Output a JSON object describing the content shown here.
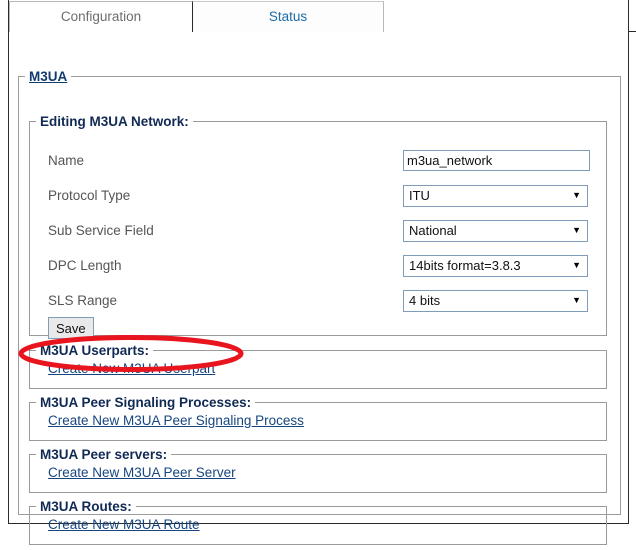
{
  "tabs": [
    {
      "id": "configuration",
      "label": "Configuration",
      "active": true
    },
    {
      "id": "status",
      "label": "Status",
      "active": false
    }
  ],
  "panel": {
    "legend": "M3UA",
    "editing_section": {
      "legend": "Editing M3UA Network:",
      "fields": [
        {
          "label": "Name",
          "type": "text",
          "value": "m3ua_network",
          "placeholder": ""
        },
        {
          "label": "Protocol Type",
          "type": "select",
          "value": "ITU"
        },
        {
          "label": "Sub Service Field",
          "type": "select",
          "value": "National"
        },
        {
          "label": "DPC Length",
          "type": "select",
          "value": "14bits format=3.8.3"
        },
        {
          "label": "SLS Range",
          "type": "select",
          "value": "4 bits"
        }
      ],
      "save_label": "Save"
    },
    "sections": [
      {
        "legend": "M3UA Userparts:",
        "link": "Create New M3UA Userpart"
      },
      {
        "legend": "M3UA Peer Signaling Processes:",
        "link": "Create New M3UA Peer Signaling Process"
      },
      {
        "legend": "M3UA Peer servers:",
        "link": "Create New M3UA Peer Server"
      },
      {
        "legend": "M3UA Routes:",
        "link": "Create New M3UA Route"
      }
    ]
  },
  "annotation": {
    "shape": "ellipse",
    "color": "#e8141e",
    "targets": "Create New M3UA Userpart"
  },
  "colors": {
    "link": "#17457f",
    "legend": "#102a54",
    "label": "#555555",
    "input_border": "#7f9db9",
    "fieldset_border": "#9a9a9a",
    "frame_border": "#2b2b2b",
    "active_tab_text": "#6d6d6d",
    "inactive_tab_text": "#1b6ca8",
    "button_bg": "#e9e9e9",
    "annotation": "#e8141e"
  }
}
